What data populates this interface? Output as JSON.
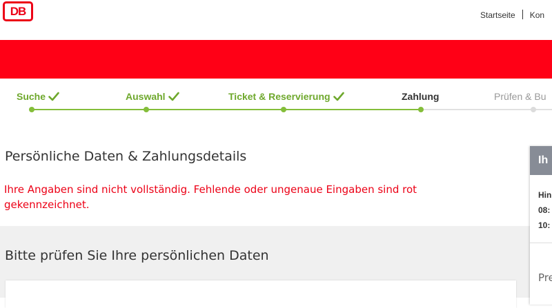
{
  "header": {
    "logo_text": "DB",
    "nav": [
      "Startseite",
      "Kon"
    ]
  },
  "steps": [
    {
      "label": "Suche",
      "state": "done"
    },
    {
      "label": "Auswahl",
      "state": "done"
    },
    {
      "label": "Ticket & Reservierung",
      "state": "done"
    },
    {
      "label": "Zahlung",
      "state": "active"
    },
    {
      "label": "Prüfen & Bu",
      "state": "todo"
    }
  ],
  "main": {
    "title": "Persönliche Daten & Zahlungsdetails",
    "error": "Ihre Angaben sind nicht vollständig. Fehlende oder ungenaue Eingaben sind rot gekennzeichnet.",
    "section_title": "Bitte prüfen Sie Ihre persönlichen Daten"
  },
  "sidebar": {
    "title": "Ih",
    "lines": [
      "Hin",
      "08:",
      "10:"
    ],
    "footer": "Pre"
  },
  "colors": {
    "brand_red": "#ec0016",
    "progress_green": "#84be3a",
    "sidebar_head": "#878c96"
  }
}
